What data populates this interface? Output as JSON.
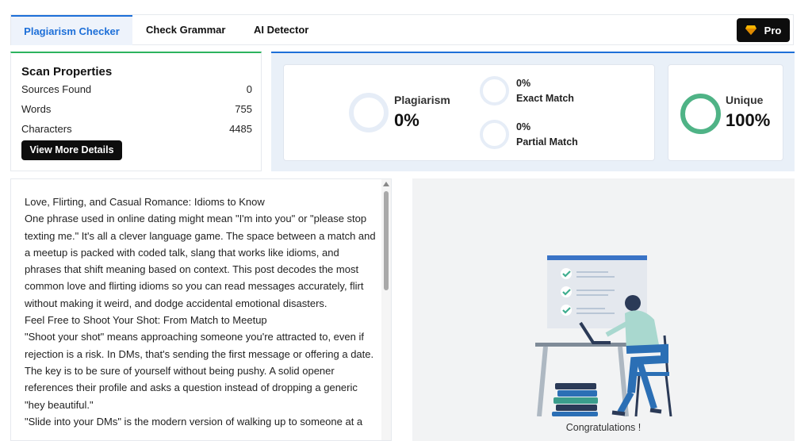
{
  "tabs": {
    "plagiarism_checker": "Plagiarism Checker",
    "check_grammar": "Check Grammar",
    "ai_detector": "AI Detector"
  },
  "pro_button": {
    "label": "Pro",
    "icon": "gem-icon"
  },
  "scan_properties": {
    "title": "Scan Properties",
    "rows": [
      {
        "label": "Sources Found",
        "value": "0"
      },
      {
        "label": "Words",
        "value": "755"
      },
      {
        "label": "Characters",
        "value": "4485"
      }
    ],
    "details_button": "View More Details"
  },
  "results": {
    "plagiarism_label": "Plagiarism",
    "plagiarism_value": "0%",
    "exact_match_value": "0%",
    "exact_match_label": "Exact Match",
    "partial_match_value": "0%",
    "partial_match_label": "Partial Match",
    "unique_label": "Unique",
    "unique_value": "100%"
  },
  "document": {
    "paragraphs": [
      "Love, Flirting, and Casual Romance: Idioms to Know",
      "One phrase used in online dating might mean \"I'm into you\" or \"please stop texting me.\" It's all a clever language game. The space between a match and a meetup is packed with coded talk, slang that works like idioms, and phrases that shift meaning based on context. This post decodes the most common love and flirting idioms so you can read messages accurately, flirt without making it weird, and dodge accidental emotional disasters.",
      "Feel Free to Shoot Your Shot: From Match to Meetup",
      "\"Shoot your shot\" means approaching someone you're attracted to, even if rejection is a risk. In DMs, that's sending the first message or offering a date. The key is to be sure of yourself without being pushy. A solid opener references their profile and asks a question instead of dropping a generic \"hey beautiful.\"",
      "\"Slide into your DMs\" is the modern version of walking up to someone at a"
    ]
  },
  "illustration": {
    "caption": "Congratulations !"
  },
  "colors": {
    "accent_blue": "#1d6fd8",
    "success_green": "#4fb386",
    "scan_green": "#2cb35e",
    "dark": "#0d0d0d"
  }
}
